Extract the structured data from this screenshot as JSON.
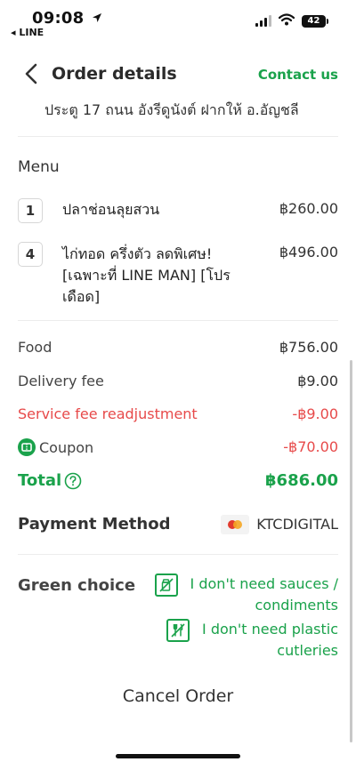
{
  "status_bar": {
    "time": "09:08",
    "back_app": "◂ LINE",
    "battery": "42"
  },
  "header": {
    "title": "Order details",
    "contact": "Contact us"
  },
  "address": "ประตู 17 ถนน อังรีดูนังต์ ฝากให้ อ.อัญชลี",
  "menu": {
    "title": "Menu",
    "items": [
      {
        "qty": "1",
        "name": "ปลาช่อนลุยสวน",
        "price": "฿260.00"
      },
      {
        "qty": "4",
        "name": "ไก่ทอด ครึ่งตัว ลดพิเศษ! [เฉพาะที่ LINE MAN] [โปรเดือด]",
        "price": "฿496.00"
      }
    ]
  },
  "summary": {
    "food_label": "Food",
    "food_value": "฿756.00",
    "delivery_label": "Delivery fee",
    "delivery_value": "฿9.00",
    "service_label": "Service fee readjustment",
    "service_value": "-฿9.00",
    "coupon_label": "Coupon",
    "coupon_value": "-฿70.00",
    "total_label": "Total",
    "total_value": "฿686.00"
  },
  "payment": {
    "label": "Payment Method",
    "value": "KTCDIGITAL"
  },
  "green_choice": {
    "label": "Green choice",
    "options": [
      {
        "line1": "I don't need sauces /",
        "line2": "condiments",
        "icon": "no-sauce-icon"
      },
      {
        "line1": "I don't need plastic",
        "line2": "cutleries",
        "icon": "no-cutlery-icon"
      }
    ]
  },
  "cancel": "Cancel Order",
  "colors": {
    "accent": "#1aa24b",
    "danger": "#e74a4a"
  }
}
